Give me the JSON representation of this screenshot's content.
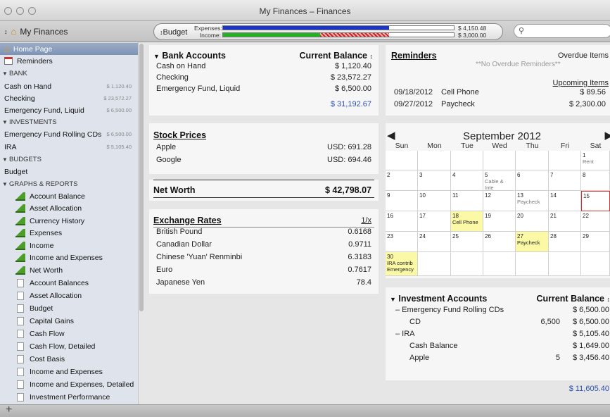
{
  "window": {
    "title": "My Finances – Finances"
  },
  "toolbar": {
    "account_switcher": "My Finances",
    "budget_button": "Budget",
    "expenses_label": "Expenses:",
    "income_label": "Income:",
    "expenses_value": "$ 4,150.48",
    "income_value": "$ 3,000.00",
    "expenses_fill": 0.72,
    "income_fill": 0.42,
    "search_placeholder": ""
  },
  "sidebar": {
    "items": [
      {
        "label": "Home Page",
        "type": "item",
        "icon": "home-icon",
        "selected": true
      },
      {
        "label": "Reminders",
        "type": "item",
        "icon": "calendar-icon"
      },
      {
        "label": "BANK",
        "type": "section"
      },
      {
        "label": "Cash on Hand",
        "type": "account",
        "amount": "$ 1,120.40"
      },
      {
        "label": "Checking",
        "type": "account",
        "amount": "$ 23,572.27"
      },
      {
        "label": "Emergency Fund, Liquid",
        "type": "account",
        "amount": "$ 6,500.00"
      },
      {
        "label": "INVESTMENTS",
        "type": "section"
      },
      {
        "label": "Emergency Fund Rolling CDs",
        "type": "account",
        "amount": "$ 6,500.00"
      },
      {
        "label": "IRA",
        "type": "account",
        "amount": "$ 5,105.40"
      },
      {
        "label": "BUDGETS",
        "type": "section"
      },
      {
        "label": "Budget",
        "type": "account"
      },
      {
        "label": "GRAPHS & REPORTS",
        "type": "section"
      },
      {
        "label": "Account Balance",
        "type": "graph",
        "icon": "chart-icon"
      },
      {
        "label": "Asset Allocation",
        "type": "graph",
        "icon": "chart-icon"
      },
      {
        "label": "Currency History",
        "type": "graph",
        "icon": "chart-icon"
      },
      {
        "label": "Expenses",
        "type": "graph",
        "icon": "chart-icon"
      },
      {
        "label": "Income",
        "type": "graph",
        "icon": "chart-icon"
      },
      {
        "label": "Income and Expenses",
        "type": "graph",
        "icon": "chart-icon"
      },
      {
        "label": "Net Worth",
        "type": "graph",
        "icon": "chart-icon"
      },
      {
        "label": "Account Balances",
        "type": "report",
        "icon": "document-icon"
      },
      {
        "label": "Asset Allocation",
        "type": "report",
        "icon": "document-icon"
      },
      {
        "label": "Budget",
        "type": "report",
        "icon": "document-icon"
      },
      {
        "label": "Capital Gains",
        "type": "report",
        "icon": "document-icon"
      },
      {
        "label": "Cash Flow",
        "type": "report",
        "icon": "document-icon"
      },
      {
        "label": "Cash Flow, Detailed",
        "type": "report",
        "icon": "document-icon"
      },
      {
        "label": "Cost Basis",
        "type": "report",
        "icon": "document-icon"
      },
      {
        "label": "Income and Expenses",
        "type": "report",
        "icon": "document-icon"
      },
      {
        "label": "Income and Expenses, Detailed",
        "type": "report",
        "icon": "document-icon"
      },
      {
        "label": "Investment Performance",
        "type": "report",
        "icon": "document-icon"
      }
    ]
  },
  "bank_accounts": {
    "title": "Bank Accounts",
    "column": "Current Balance",
    "rows": [
      {
        "name": "Cash on Hand",
        "value": "$ 1,120.40"
      },
      {
        "name": "Checking",
        "value": "$ 23,572.27"
      },
      {
        "name": "Emergency Fund, Liquid",
        "value": "$ 6,500.00"
      }
    ],
    "total": "$ 31,192.67"
  },
  "stock_prices": {
    "title": "Stock Prices",
    "rows": [
      {
        "name": "Apple",
        "value": "USD: 691.28"
      },
      {
        "name": "Google",
        "value": "USD: 694.46"
      }
    ]
  },
  "net_worth": {
    "title": "Net Worth",
    "value": "$ 42,798.07"
  },
  "exchange_rates": {
    "title": "Exchange Rates",
    "toggle": "1/x",
    "rows": [
      {
        "name": "British Pound",
        "value": "0.6168"
      },
      {
        "name": "Canadian Dollar",
        "value": "0.9711"
      },
      {
        "name": "Chinese 'Yuan' Renminbi",
        "value": "6.3183"
      },
      {
        "name": "Euro",
        "value": "0.7617"
      },
      {
        "name": "Japanese Yen",
        "value": "78.4"
      }
    ]
  },
  "reminders": {
    "title": "Reminders",
    "overdue_label": "Overdue Items",
    "no_overdue": "**No Overdue Reminders**",
    "upcoming_label": "Upcoming Items",
    "upcoming_first_amount": "$ 89.56",
    "items": [
      {
        "date": "09/18/2012",
        "name": "Cell Phone",
        "amount": ""
      },
      {
        "date": "09/27/2012",
        "name": "Paycheck",
        "amount": "$ 2,300.00"
      }
    ]
  },
  "calendar": {
    "month": "September 2012",
    "prev": "◀",
    "next": "▶",
    "weekdays": [
      "Sun",
      "Mon",
      "Tue",
      "Wed",
      "Thu",
      "Fri",
      "Sat"
    ],
    "weeks": [
      [
        {
          "d": ""
        },
        {
          "d": ""
        },
        {
          "d": ""
        },
        {
          "d": ""
        },
        {
          "d": ""
        },
        {
          "d": ""
        },
        {
          "d": "1",
          "e": "Rent"
        }
      ],
      [
        {
          "d": "2"
        },
        {
          "d": "3"
        },
        {
          "d": "4"
        },
        {
          "d": "5",
          "e": "Cable & Inte"
        },
        {
          "d": "6"
        },
        {
          "d": "7"
        },
        {
          "d": "8"
        }
      ],
      [
        {
          "d": "9"
        },
        {
          "d": "10"
        },
        {
          "d": "11"
        },
        {
          "d": "12"
        },
        {
          "d": "13",
          "e": "Paycheck"
        },
        {
          "d": "14"
        },
        {
          "d": "15",
          "today": true
        }
      ],
      [
        {
          "d": "16"
        },
        {
          "d": "17"
        },
        {
          "d": "18",
          "e": "Cell Phone",
          "hl": true
        },
        {
          "d": "19"
        },
        {
          "d": "20"
        },
        {
          "d": "21"
        },
        {
          "d": "22"
        }
      ],
      [
        {
          "d": "23"
        },
        {
          "d": "24"
        },
        {
          "d": "25"
        },
        {
          "d": "26"
        },
        {
          "d": "27",
          "e": "Paycheck",
          "hl": true
        },
        {
          "d": "28"
        },
        {
          "d": "29"
        }
      ],
      [
        {
          "d": "30",
          "e": "IRA contrib\nEmergency",
          "hl": true
        },
        {
          "d": ""
        },
        {
          "d": ""
        },
        {
          "d": ""
        },
        {
          "d": ""
        },
        {
          "d": ""
        },
        {
          "d": ""
        }
      ]
    ]
  },
  "investment_accounts": {
    "title": "Investment Accounts",
    "column": "Current Balance",
    "rows": [
      {
        "name": "–  Emergency Fund Rolling CDs",
        "qty": "",
        "value": "$ 6,500.00",
        "indent": 0
      },
      {
        "name": "CD",
        "qty": "6,500",
        "value": "$ 6,500.00",
        "indent": 1
      },
      {
        "name": "–  IRA",
        "qty": "",
        "value": "$ 5,105.40",
        "indent": 0
      },
      {
        "name": "Cash Balance",
        "qty": "",
        "value": "$ 1,649.00",
        "indent": 1
      },
      {
        "name": "Apple",
        "qty": "5",
        "value": "$ 3,456.40",
        "indent": 1
      }
    ],
    "total": "$ 11,605.40"
  },
  "colors": {
    "expenses_bar": "#1a35c8",
    "income_bar": "#22b322",
    "total_blue": "#2b4fb0",
    "calendar_highlight": "#fbf9a5"
  }
}
